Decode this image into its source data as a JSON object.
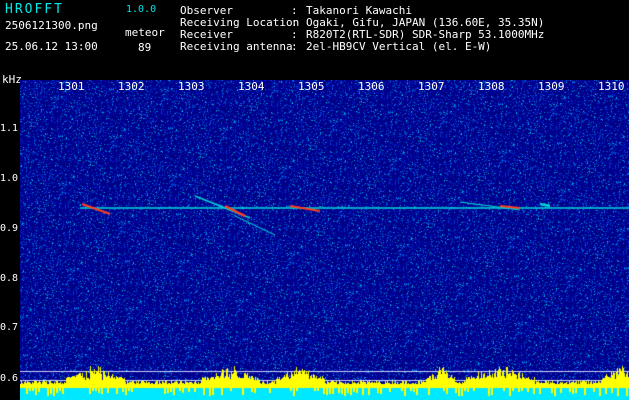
{
  "app": {
    "name": "HROFFT",
    "version": "1.0.0"
  },
  "file": {
    "name": "2506121300.png",
    "timestamp": "25.06.12 13:00"
  },
  "meteor": {
    "label": "meteor",
    "count": "89"
  },
  "info": [
    {
      "key": "Observer",
      "value": "Takanori Kawachi"
    },
    {
      "key": "Receiving Location",
      "value": "Ogaki, Gifu, JAPAN (136.60E, 35.35N)"
    },
    {
      "key": "Receiver",
      "value": "R820T2(RTL-SDR) SDR-Sharp 53.1000MHz"
    },
    {
      "key": "Receiving antenna",
      "value": "2el-HB9CV Vertical (el. E-W)"
    }
  ],
  "colon": ":",
  "axis": {
    "y_unit": "kHz",
    "y_ticks": [
      "1.1",
      "1.0",
      "0.9",
      "0.8",
      "0.7",
      "0.6"
    ],
    "x_ticks": [
      "1301",
      "1302",
      "1303",
      "1304",
      "1305",
      "1306",
      "1307",
      "1308",
      "1309",
      "1310"
    ]
  },
  "colors": {
    "background": "#000080",
    "carrier": "#00d8d8",
    "meteor": "#ff4020",
    "baseline": "#ffff00",
    "band": "#00e8ff"
  }
}
